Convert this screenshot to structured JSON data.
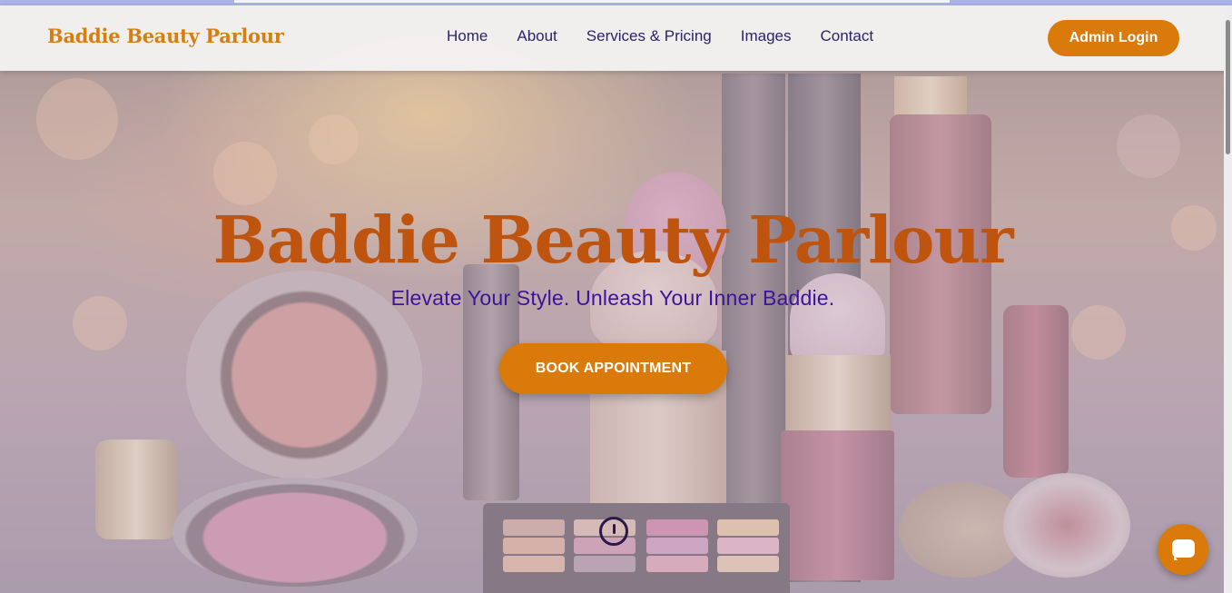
{
  "brand": {
    "name": "Baddie Beauty Parlour"
  },
  "nav": {
    "links": [
      {
        "label": "Home"
      },
      {
        "label": "About"
      },
      {
        "label": "Services & Pricing"
      },
      {
        "label": "Images"
      },
      {
        "label": "Contact"
      }
    ],
    "admin_login_label": "Admin Login"
  },
  "hero": {
    "title": "Baddie Beauty Parlour",
    "subtitle": "Elevate Your Style. Unleash Your Inner Baddie.",
    "cta_label": "BOOK APPOINTMENT",
    "background_image": "makeup-products-photo",
    "scroll_indicator_icon": "scroll-down-icon"
  },
  "chat": {
    "icon": "chat-bubble-icon"
  },
  "colors": {
    "accent": "#d97a0a",
    "brand_text": "#d67f10",
    "hero_title": "#bf540f",
    "hero_subtitle": "#3c139c",
    "nav_text": "#2b2466"
  }
}
